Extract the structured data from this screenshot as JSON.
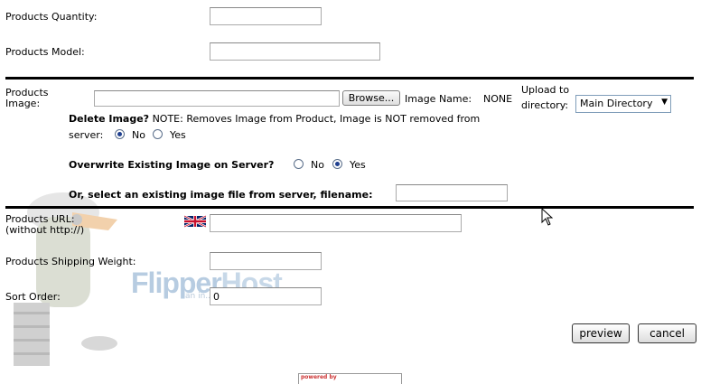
{
  "form": {
    "quantity_label": "Products Quantity:",
    "quantity_value": "",
    "model_label": "Products Model:",
    "model_value": "",
    "image_label_line1": "Products",
    "image_label_line2": "Image:",
    "browse_label": "Browse...",
    "image_name_label": "Image Name:",
    "image_name_value": "NONE",
    "upload_label_line1": "Upload to",
    "upload_label_line2": "directory:",
    "upload_select": "Main Directory",
    "delete_image_label": "Delete Image?",
    "delete_note_line1": "NOTE: Removes Image from Product, Image is NOT removed from",
    "delete_note_line2": "server:",
    "delete_options": {
      "no": "No",
      "yes": "Yes",
      "selected": "No"
    },
    "overwrite_label": "Overwrite Existing Image on Server?",
    "overwrite_options": {
      "no": "No",
      "yes": "Yes",
      "selected": "Yes"
    },
    "existing_file_label": "Or, select an existing image file from server, filename:",
    "existing_file_value": "",
    "url_label_line1": "Products URL:",
    "url_label_line2": "(without http://)",
    "url_flag_icon": "uk-flag-icon",
    "url_value": "",
    "shipping_label": "Products Shipping Weight:",
    "shipping_value": "",
    "sort_label": "Sort Order:",
    "sort_value": "0",
    "preview_label": "preview",
    "cancel_label": "cancel"
  },
  "watermark": {
    "brand_flipper": "Flipper",
    "brand_host": "Host",
    "tagline": "an in... ...om company",
    "colors": {
      "flipper": "#7ea4c9",
      "host": "#9bb9d6"
    }
  },
  "footer": {
    "powered_by": "powered by"
  }
}
